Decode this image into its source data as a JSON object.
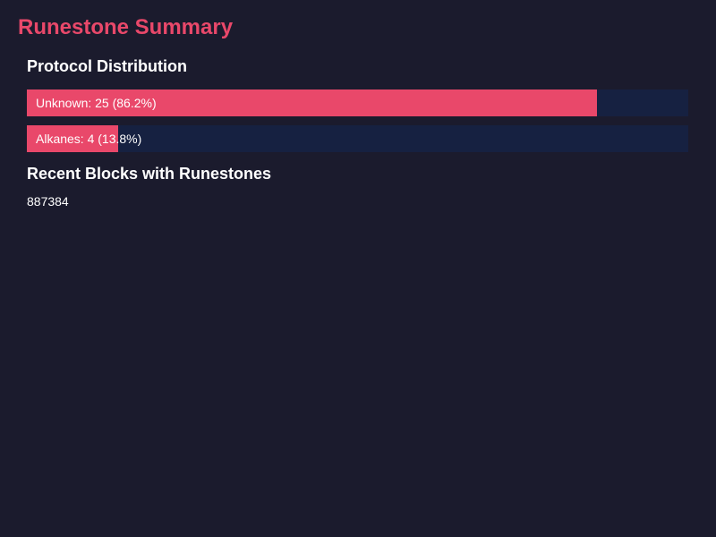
{
  "page": {
    "title": "Runestone Summary"
  },
  "protocol_distribution": {
    "title": "Protocol Distribution",
    "items": [
      {
        "label": "Unknown: 25 (86.2%)",
        "name": "Unknown",
        "count": 25,
        "percent": 86.2
      },
      {
        "label": "Alkanes: 4 (13.8%)",
        "name": "Alkanes",
        "count": 4,
        "percent": 13.8
      }
    ]
  },
  "recent_blocks": {
    "title": "Recent Blocks with Runestones",
    "blocks": [
      "887384"
    ]
  },
  "colors": {
    "background": "#1b1b2d",
    "accent": "#e9486a",
    "bar_track": "#162141",
    "text": "#ffffff"
  }
}
